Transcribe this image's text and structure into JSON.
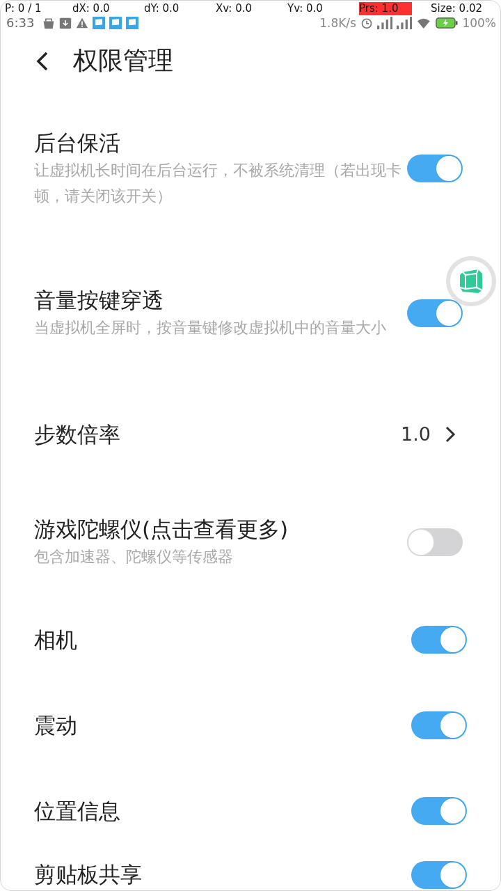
{
  "status_bar": {
    "time": "6:33",
    "net_speed": "1.8K/s",
    "battery": "100%"
  },
  "pointer_overlay": [
    {
      "text": "P: 0 / 1",
      "highlight": false
    },
    {
      "text": "dX: 0.0",
      "highlight": false
    },
    {
      "text": "dY: 0.0",
      "highlight": false
    },
    {
      "text": "Xv: 0.0",
      "highlight": false
    },
    {
      "text": "Yv: 0.0",
      "highlight": false
    },
    {
      "text": "Prs: 1.0",
      "highlight": true
    },
    {
      "text": "Size: 0.02",
      "highlight": false
    }
  ],
  "header": {
    "title": "权限管理"
  },
  "settings": [
    {
      "kind": "switch",
      "title": "后台保活",
      "description": "让虚拟机长时间在后台运行，不被系统清理（若出现卡顿，请关闭该开关）",
      "on": true
    },
    {
      "kind": "switch",
      "title": "音量按键穿透",
      "description": "当虚拟机全屏时，按音量键修改虚拟机中的音量大小",
      "on": true
    },
    {
      "kind": "value",
      "title": "步数倍率",
      "value": "1.0"
    },
    {
      "kind": "switch",
      "title": "游戏陀螺仪(点击查看更多)",
      "description": "包含加速器、陀螺仪等传感器",
      "on": false
    },
    {
      "kind": "switch",
      "title": "相机",
      "on": true
    },
    {
      "kind": "switch",
      "title": "震动",
      "on": true
    },
    {
      "kind": "switch",
      "title": "位置信息",
      "on": true
    },
    {
      "kind": "switch",
      "title": "剪贴板共享",
      "on": true
    }
  ]
}
